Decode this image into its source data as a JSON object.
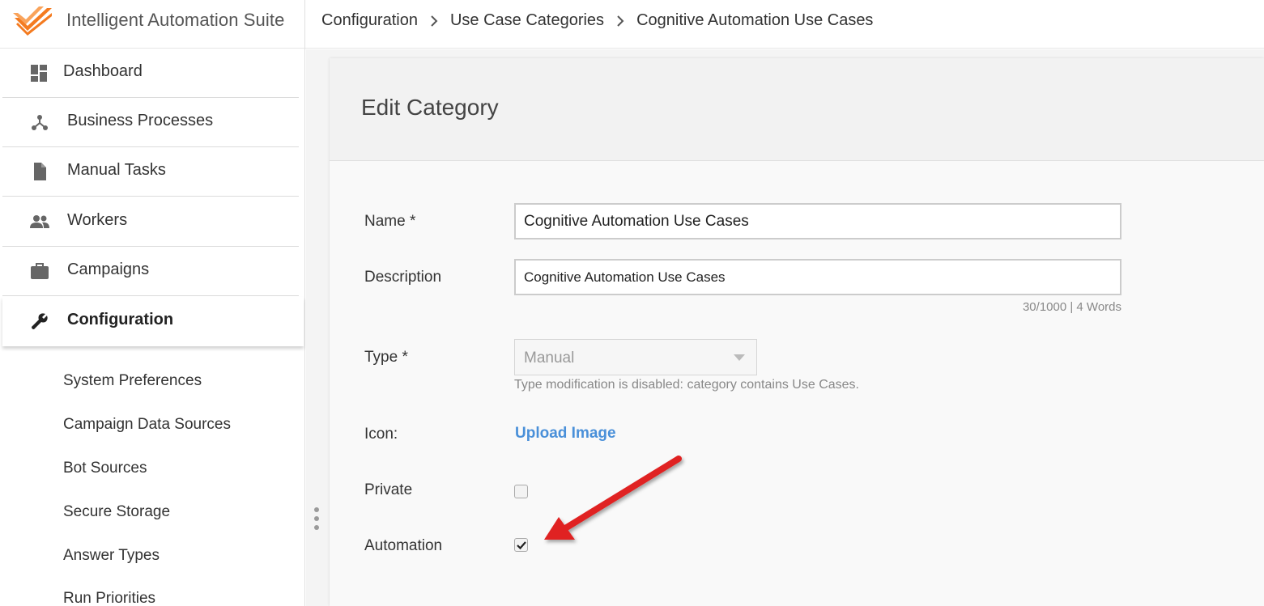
{
  "app": {
    "title": "Intelligent Automation Suite",
    "brand_color": "#f47b20"
  },
  "breadcrumb": {
    "items": [
      "Configuration",
      "Use Case Categories",
      "Cognitive Automation Use Cases"
    ]
  },
  "sidebar": {
    "items": [
      {
        "label": "Dashboard",
        "icon": "dashboard-icon"
      },
      {
        "label": "Business Processes",
        "icon": "process-icon"
      },
      {
        "label": "Manual Tasks",
        "icon": "document-icon"
      },
      {
        "label": "Workers",
        "icon": "people-icon"
      },
      {
        "label": "Campaigns",
        "icon": "briefcase-icon"
      },
      {
        "label": "Configuration",
        "icon": "wrench-icon",
        "active": true
      }
    ],
    "sub_items": [
      "System Preferences",
      "Campaign Data Sources",
      "Bot Sources",
      "Secure Storage",
      "Answer Types",
      "Run Priorities"
    ]
  },
  "form": {
    "title": "Edit Category",
    "name": {
      "label": "Name *",
      "value": "Cognitive Automation Use Cases"
    },
    "description": {
      "label": "Description",
      "value": "Cognitive Automation Use Cases",
      "counter": "30/1000 | 4 Words"
    },
    "type": {
      "label": "Type *",
      "value": "Manual",
      "hint": "Type modification is disabled: category contains Use Cases."
    },
    "icon": {
      "label": "Icon:",
      "link": "Upload Image"
    },
    "private": {
      "label": "Private",
      "checked": false
    },
    "automation": {
      "label": "Automation",
      "checked": true
    }
  },
  "colors": {
    "link": "#4a90d9",
    "annotation_arrow": "#e02020"
  }
}
